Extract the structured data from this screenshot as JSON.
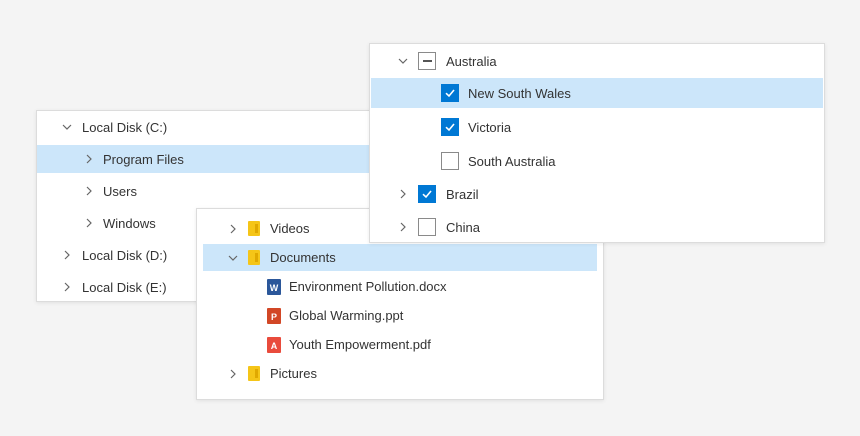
{
  "colors": {
    "selected_row": "#cce6fa",
    "checkbox_checked": "#0078d4",
    "folder": "#f5c518",
    "word": "#2b579a",
    "powerpoint": "#d24726",
    "pdf": "#e94b3c"
  },
  "disks": {
    "items": [
      {
        "label": "Local Disk (C:)",
        "expanded": true,
        "icon": "chevron-down-icon"
      },
      {
        "label": "Program Files",
        "selected": true,
        "icon": "chevron-right-icon"
      },
      {
        "label": "Users",
        "icon": "chevron-right-icon"
      },
      {
        "label": "Windows",
        "icon": "chevron-right-icon"
      },
      {
        "label": "Local Disk (D:)",
        "icon": "chevron-right-icon"
      },
      {
        "label": "Local Disk (E:)",
        "icon": "chevron-right-icon"
      }
    ]
  },
  "files": {
    "items": [
      {
        "label": "Videos",
        "type": "folder",
        "icon": "folder-icon"
      },
      {
        "label": "Documents",
        "type": "folder",
        "expanded": true,
        "selected": true,
        "icon": "folder-icon"
      },
      {
        "label": "Environment Pollution.docx",
        "type": "word",
        "icon": "word-file-icon",
        "badge": "W"
      },
      {
        "label": "Global Warming.ppt",
        "type": "powerpoint",
        "icon": "powerpoint-file-icon",
        "badge": "P"
      },
      {
        "label": "Youth Empowerment.pdf",
        "type": "pdf",
        "icon": "pdf-file-icon",
        "badge": "A"
      },
      {
        "label": "Pictures",
        "type": "folder",
        "icon": "folder-icon"
      }
    ]
  },
  "regions": {
    "items": [
      {
        "label": "Australia",
        "state": "indeterminate",
        "expanded": true
      },
      {
        "label": "New South Wales",
        "state": "checked",
        "selected": true
      },
      {
        "label": "Victoria",
        "state": "checked"
      },
      {
        "label": "South Australia",
        "state": "unchecked"
      },
      {
        "label": "Brazil",
        "state": "checked"
      },
      {
        "label": "China",
        "state": "unchecked"
      }
    ]
  }
}
